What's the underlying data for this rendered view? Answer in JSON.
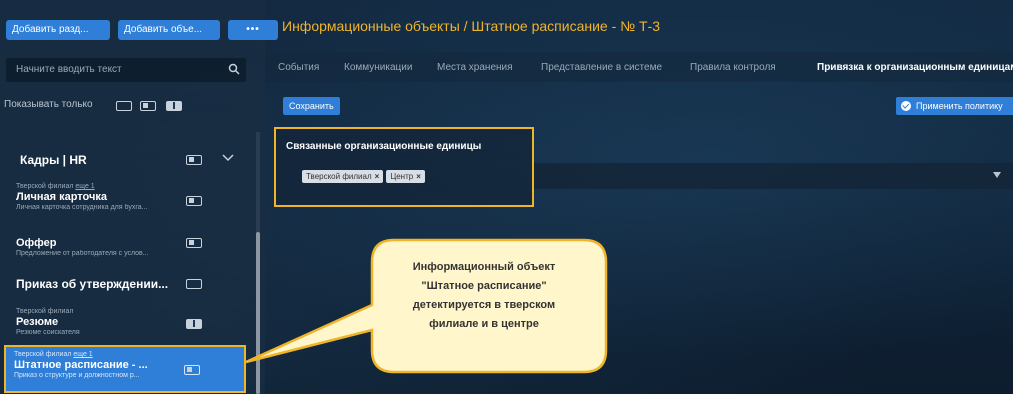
{
  "sidebar": {
    "add_section_label": "Добавить разд...",
    "add_object_label": "Добавить объе...",
    "more_label": "•••",
    "search_placeholder": "Начните вводить текст",
    "filter_label": "Показывать только",
    "group_title": "Кадры | HR",
    "items": [
      {
        "meta": "Тверской филиал",
        "meta_more": "еще 1",
        "title": "Личная карточка",
        "subtitle": "Личная карточка сотрудника для бухга..."
      },
      {
        "meta": "",
        "meta_more": "",
        "title": "Оффер",
        "subtitle": "Предложение от работодателя с услов..."
      },
      {
        "meta": "",
        "meta_more": "",
        "title": "Приказ об утверждении...",
        "subtitle": ""
      },
      {
        "meta": "Тверской филиал",
        "meta_more": "",
        "title": "Резюме",
        "subtitle": "Резюме соискателя"
      },
      {
        "meta": "Тверской филиал",
        "meta_more": "еще 1",
        "title": "Штатное расписание - ...",
        "subtitle": "Приказ о структуре и должностном р..."
      }
    ]
  },
  "header": {
    "title": "Информационные объекты / Штатное расписание - № Т-3"
  },
  "tabs": [
    {
      "label": "События"
    },
    {
      "label": "Коммуникации"
    },
    {
      "label": "Места хранения"
    },
    {
      "label": "Представление в системе"
    },
    {
      "label": "Правила контроля"
    },
    {
      "label": "Привязка к организационным единицам"
    }
  ],
  "toolbar": {
    "save_label": "Сохранить",
    "apply_policy_label": "Применить политику"
  },
  "linked_units": {
    "label": "Связанные организационные единицы",
    "chips": [
      {
        "label": "Тверской филиал",
        "remove": "×"
      },
      {
        "label": "Центр",
        "remove": "×"
      }
    ]
  },
  "callout": {
    "line1": "Информационный объект",
    "line2": "\"Штатное расписание\"",
    "line3": "детектируется в тверском",
    "line4": "филиале и в центре"
  },
  "colors": {
    "accent": "#2f7ed8",
    "highlight": "#f0b429",
    "callout_fill": "#fff6cc"
  }
}
